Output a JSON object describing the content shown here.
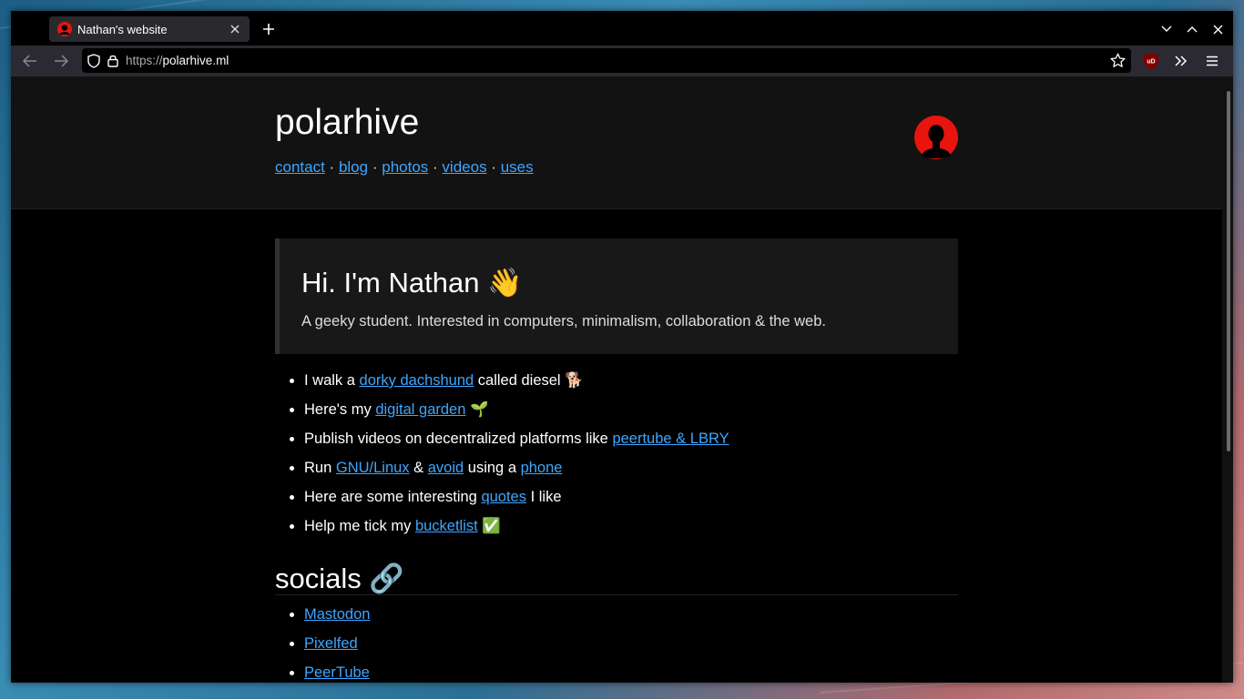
{
  "browser": {
    "tab_title": "Nathan's website",
    "url_scheme": "https://",
    "url_host": "polarhive.ml"
  },
  "site": {
    "title": "polarhive",
    "nav": [
      {
        "label": "contact"
      },
      {
        "label": "blog"
      },
      {
        "label": "photos"
      },
      {
        "label": "videos"
      },
      {
        "label": "uses"
      }
    ],
    "nav_separator": "·"
  },
  "hero": {
    "title": "Hi. I'm Nathan",
    "title_emoji": "👋",
    "subtitle": "A geeky student. Interested in computers, minimalism, collaboration & the web."
  },
  "facts": [
    {
      "pre": "I walk a ",
      "link": "dorky dachshund",
      "post": " called diesel ",
      "emoji": "🐕"
    },
    {
      "pre": "Here's my ",
      "link": "digital garden",
      "post": " ",
      "emoji": "🌱"
    },
    {
      "pre": "Publish videos on decentralized platforms like ",
      "link": "peertube ",
      "mid": "& ",
      "link2": "LBRY"
    },
    {
      "pre": "Run ",
      "link": "GNU/Linux",
      "mid": " & ",
      "link2": "avoid",
      "mid2": " using a ",
      "link3": "phone"
    },
    {
      "pre": "Here are some interesting ",
      "link": "quotes",
      "post": " I like"
    },
    {
      "pre": "Help me tick my ",
      "link": "bucketlist",
      "post": " ",
      "emoji": "✅"
    }
  ],
  "socials": {
    "title": "socials",
    "title_emoji": "🔗",
    "items": [
      {
        "label": "Mastodon"
      },
      {
        "label": "Pixelfed"
      },
      {
        "label": "PeerTube"
      }
    ]
  },
  "colors": {
    "link": "#3ea6ff",
    "avatar_red": "#e8140e",
    "header_bg": "#121212"
  }
}
